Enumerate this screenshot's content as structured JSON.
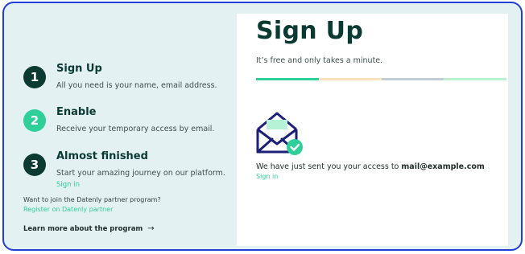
{
  "colors": {
    "frame_border": "#1f3fd6",
    "background": "#e4f1f3",
    "dark_green": "#0b3a33",
    "accent_green": "#2ecf98",
    "card": "#ffffff"
  },
  "steps": [
    {
      "number": "1",
      "title": "Sign Up",
      "description": "All you need is your name, email address.",
      "badge_color": "#0b3a33"
    },
    {
      "number": "2",
      "title": "Enable",
      "description": "Receive your temporary access by email.",
      "badge_color": "#2ecf98"
    },
    {
      "number": "3",
      "title": "Almost finished",
      "description": "Start your amazing journey on our platform.",
      "link": "Sign in",
      "badge_color": "#0b3a33"
    }
  ],
  "partner": {
    "question": "Want to join the Datenly partner program?",
    "link": "Register on Datenly partner"
  },
  "learn_more": {
    "label": "Learn more about the program",
    "icon": "arrow-right-icon"
  },
  "card": {
    "title": "Sign Up",
    "subtitle": "It’s free and only takes a minute.",
    "progress_segments": [
      "#2ecf98",
      "#fde2c0",
      "#c2cdd2",
      "#bdf0cf"
    ],
    "envelope_icon": "envelope-check-icon",
    "message_prefix": "We have just sent you your access to ",
    "email": "mail@example.com",
    "signin_link": "Sign in"
  }
}
